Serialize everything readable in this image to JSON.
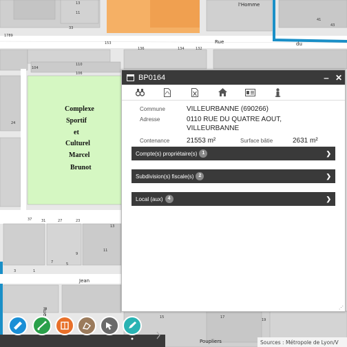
{
  "map": {
    "streets": [
      {
        "label": "Rue"
      },
      {
        "label": "du"
      },
      {
        "label": "l'Homme"
      },
      {
        "label": "Jean"
      },
      {
        "label": "Rue"
      },
      {
        "label": "Poupliers"
      }
    ],
    "places": [
      "Complexe",
      "Sportif",
      "et",
      "Culturel",
      "Marcel",
      "Brunot"
    ],
    "numbers": [
      "1789",
      "136",
      "134",
      "132",
      "110",
      "153",
      "104",
      "106",
      "11",
      "13",
      "33",
      "24",
      "37",
      "31",
      "27",
      "23",
      "3",
      "1",
      "7",
      "5",
      "9",
      "11",
      "13",
      "15",
      "17",
      "19",
      "41",
      "43"
    ],
    "attribution": "Sources : Métropole de Lyon/V",
    "colors": {
      "park": "#d5f7c2",
      "building": "#c8c8c8",
      "highlight": "#f5b065",
      "road": "#ffffff",
      "boundary": "#1a8fc7"
    }
  },
  "panel": {
    "title": "BP0164",
    "toolbar_icons": [
      "binoculars-icon",
      "pdf-icon",
      "excel-icon",
      "home-icon",
      "id-card-icon",
      "person-icon"
    ],
    "fields": {
      "commune_label": "Commune",
      "commune_value": "VILLEURBANNE (690266)",
      "adresse_label": "Adresse",
      "adresse_line1": "0110 RUE DU QUATRE AOUT,",
      "adresse_line2": "VILLEURBANNE",
      "contenance_label": "Contenance",
      "contenance_value": "21553 m²",
      "surface_label": "Surface bâtie",
      "surface_value": "2631 m²"
    },
    "sections": [
      {
        "label": "Compte(s) propriétaire(s)",
        "count": "1"
      },
      {
        "label": "Subdivision(s) fiscale(s)",
        "count": "2"
      },
      {
        "label": "Local (aux)",
        "count": "4"
      }
    ]
  },
  "tools": [
    {
      "name": "ruler-tool",
      "color": "#1a8fd6"
    },
    {
      "name": "measure-tool",
      "color": "#2aa04a"
    },
    {
      "name": "print-tool",
      "color": "#e8702a"
    },
    {
      "name": "draw-tool",
      "color": "#9b7b5c"
    },
    {
      "name": "select-tool",
      "color": "#6a6a6a"
    },
    {
      "name": "edit-tool",
      "color": "#29b3b3"
    }
  ]
}
